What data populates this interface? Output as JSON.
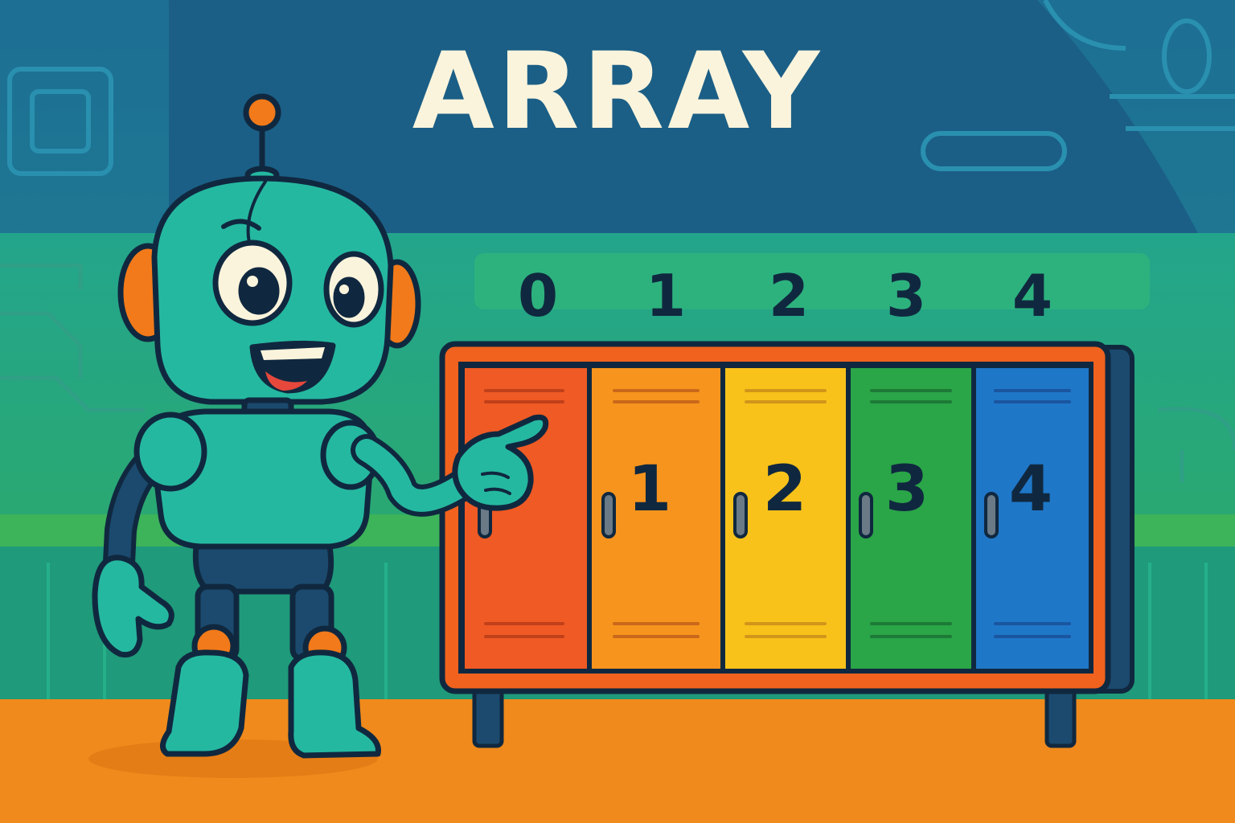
{
  "title": "ARRAY",
  "indices": [
    "0",
    "1",
    "2",
    "3",
    "4"
  ],
  "values": [
    "",
    "1",
    "2",
    "3",
    "4"
  ],
  "colors": {
    "background_top": "#1d6f93",
    "background_mid": "#23a07a",
    "floor": "#f08a1c",
    "robot_body": "#25b8a0",
    "robot_accent": "#f27a1a",
    "outline": "#10283f",
    "locker_frame": "#f0621e",
    "lockers": [
      "#f05a24",
      "#f7941d",
      "#f8c21a",
      "#2aa548",
      "#1f77c8"
    ]
  },
  "icons": {
    "character": "robot-icon",
    "cabinet": "locker-cabinet-icon"
  }
}
